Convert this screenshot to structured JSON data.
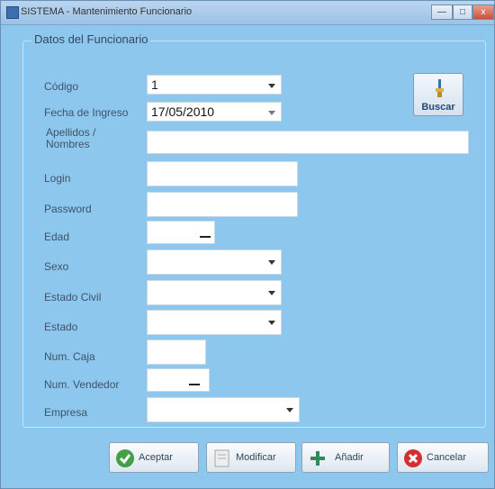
{
  "window": {
    "title": "SISTEMA - Mantenimiento Funcionario",
    "min_label": "—",
    "max_label": "□",
    "close_label": "x"
  },
  "group": {
    "legend": "Datos del Funcionario"
  },
  "fields": {
    "codigo": {
      "label": "Código",
      "value": "1"
    },
    "fecha": {
      "label": "Fecha de Ingreso",
      "value": "17/05/2010"
    },
    "nombres": {
      "label": "Apellidos / Nombres",
      "value": ""
    },
    "login": {
      "label": "Login",
      "value": ""
    },
    "password": {
      "label": "Password",
      "value": ""
    },
    "edad": {
      "label": "Edad",
      "value": ""
    },
    "sexo": {
      "label": "Sexo",
      "value": ""
    },
    "estado_civil": {
      "label": "Estado Civil",
      "value": ""
    },
    "estado": {
      "label": "Estado",
      "value": ""
    },
    "num_caja": {
      "label": "Num. Caja",
      "value": ""
    },
    "num_vendedor": {
      "label": "Num. Vendedor",
      "value": ""
    },
    "empresa": {
      "label": "Empresa",
      "value": ""
    }
  },
  "buttons": {
    "buscar": "Buscar",
    "aceptar": "Aceptar",
    "modificar": "Modificar",
    "anadir": "Añadir",
    "cancelar": "Cancelar"
  },
  "colors": {
    "window_bg": "#8ec7ee",
    "accept_icon": "#43a047",
    "cancel_icon": "#d32f2f"
  }
}
